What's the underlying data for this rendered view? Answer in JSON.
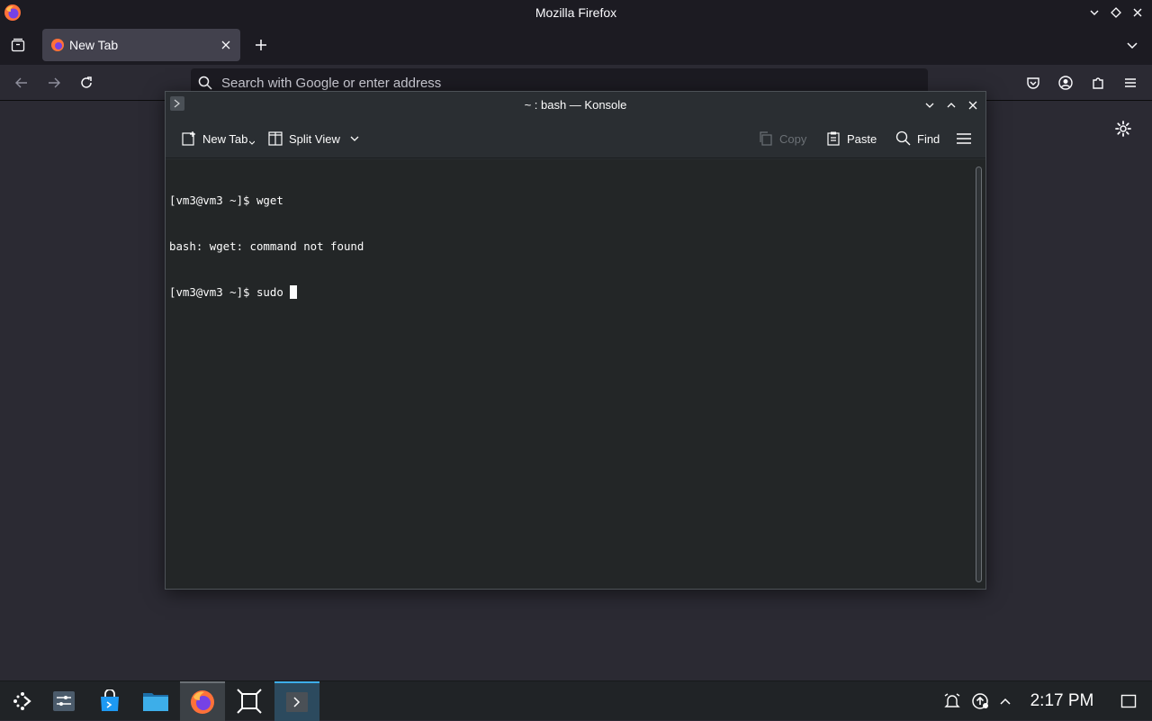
{
  "firefox": {
    "window_title": "Mozilla Firefox",
    "tab": {
      "label": "New Tab"
    },
    "urlbar": {
      "placeholder": "Search with Google or enter address"
    }
  },
  "konsole": {
    "window_title": "~ : bash — Konsole",
    "toolbar": {
      "new_tab": "New Tab",
      "split_view": "Split View",
      "copy": "Copy",
      "paste": "Paste",
      "find": "Find"
    },
    "terminal": {
      "lines": [
        "[vm3@vm3 ~]$ wget",
        "bash: wget: command not found",
        "[vm3@vm3 ~]$ sudo "
      ]
    }
  },
  "taskbar": {
    "clock": "2:17 PM",
    "apps": [
      "application-launcher",
      "system-settings",
      "discover",
      "dolphin",
      "firefox",
      "window-overview",
      "konsole"
    ]
  },
  "colors": {
    "accent": "#3daee9",
    "terminal_bg": "#232627",
    "firefox_bg": "#2b2a33"
  }
}
